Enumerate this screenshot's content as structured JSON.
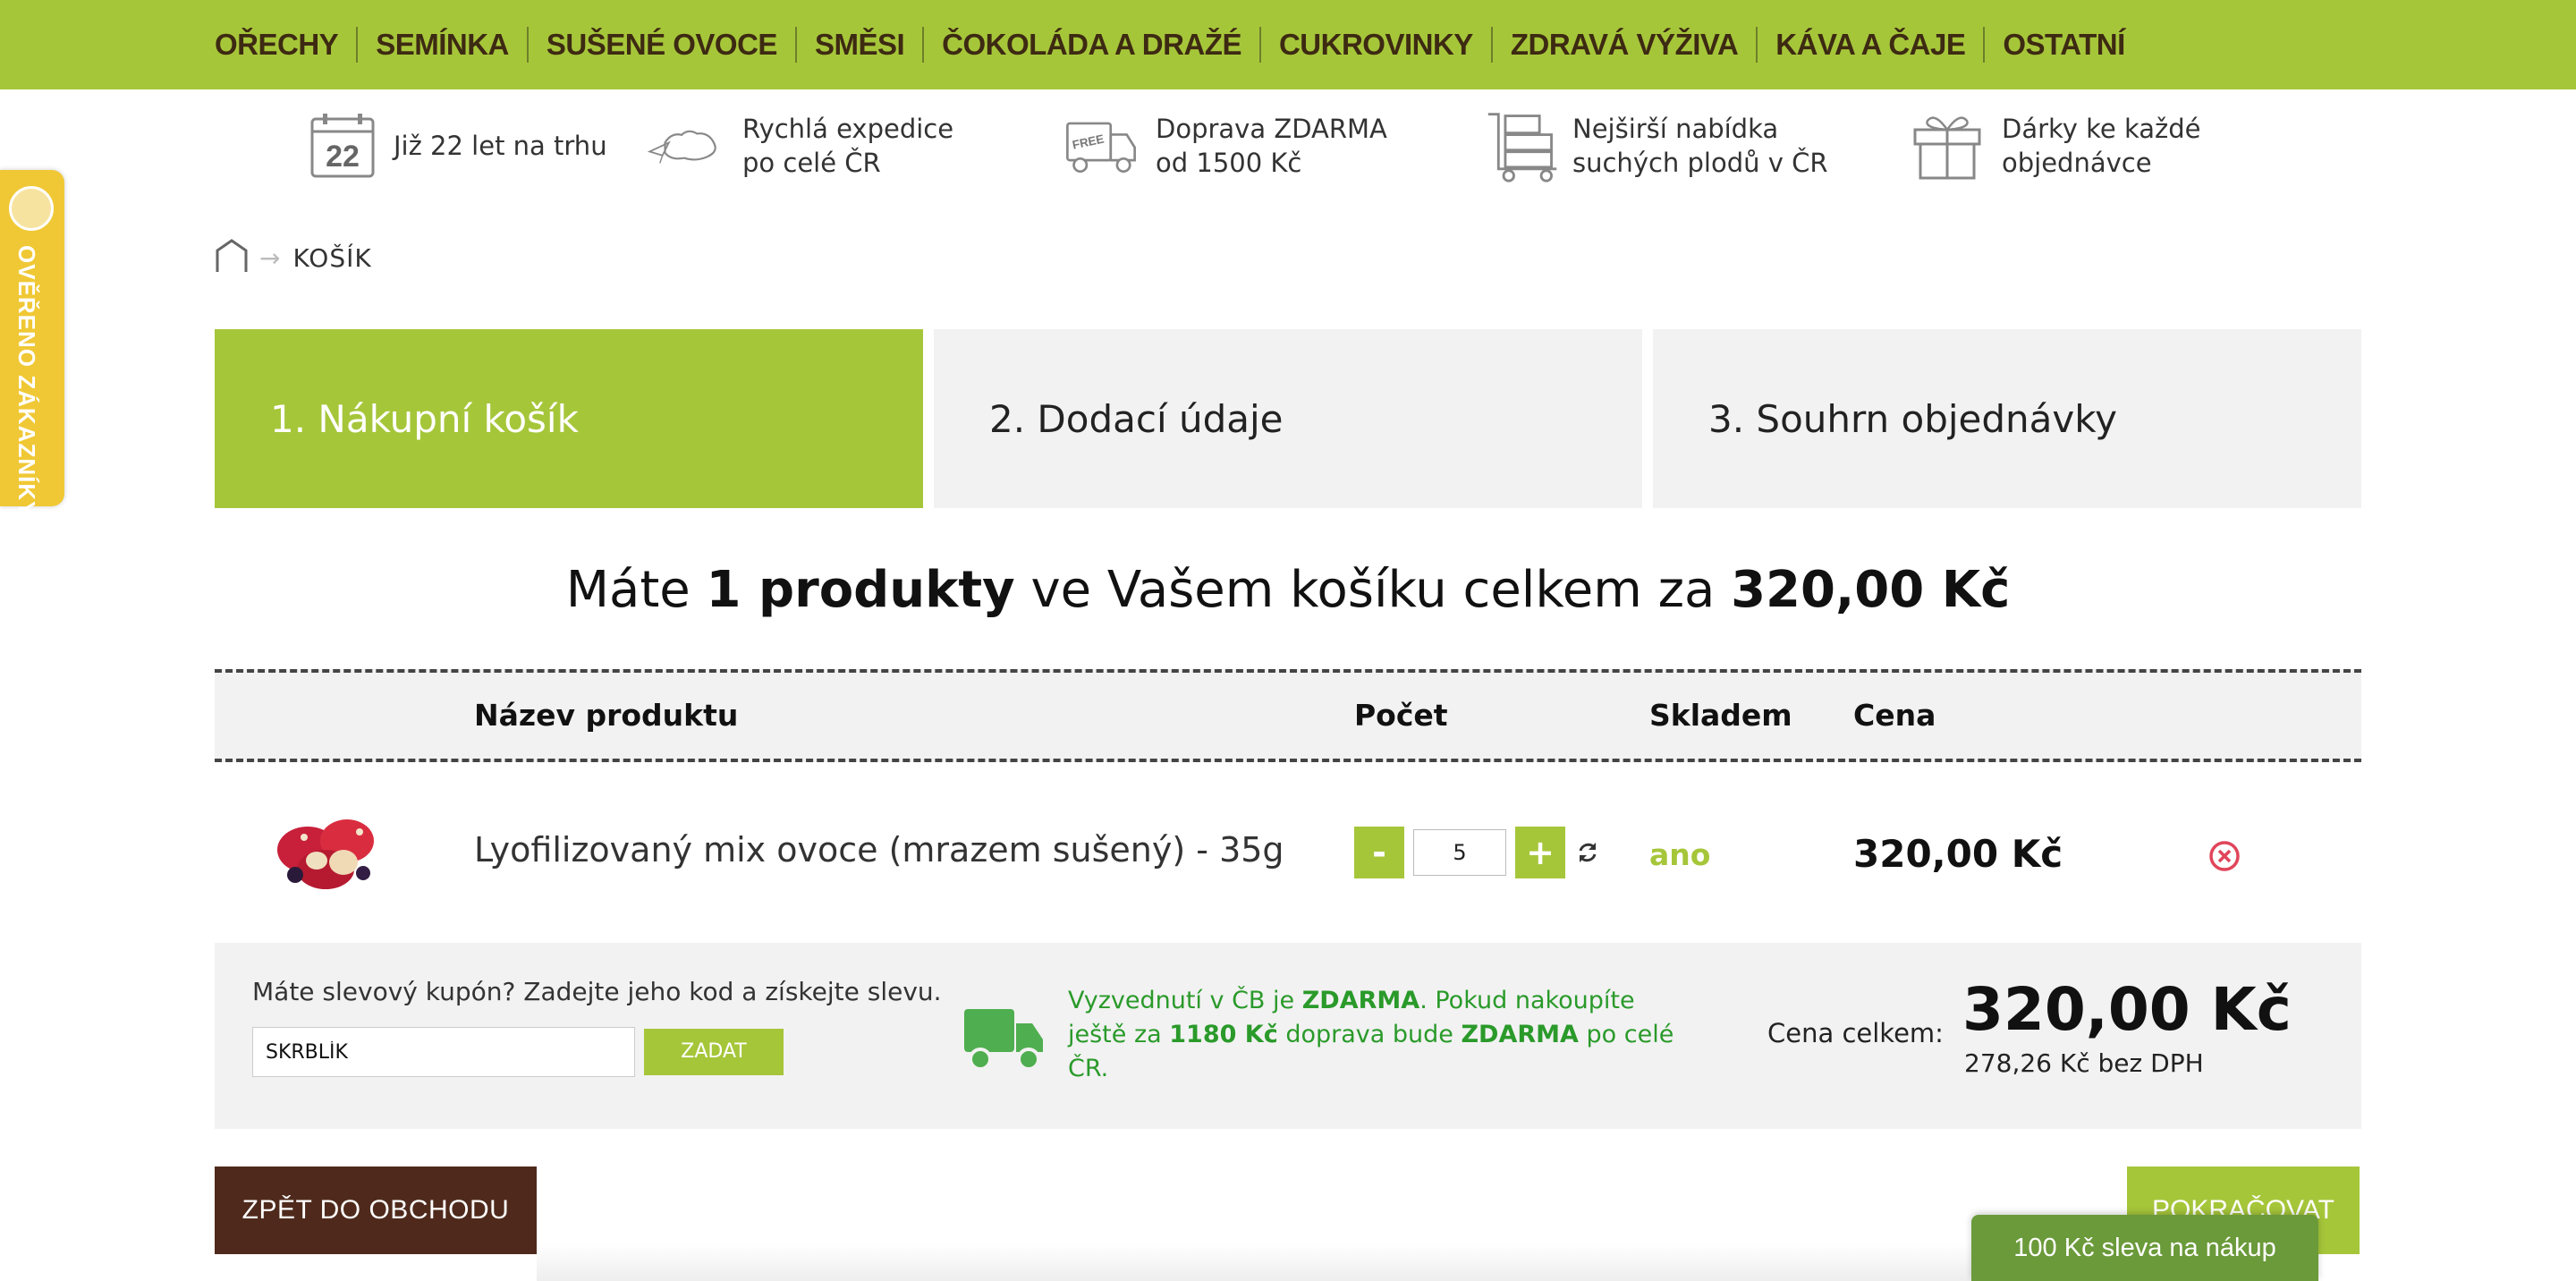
{
  "nav": {
    "items": [
      "OŘECHY",
      "SEMÍNKA",
      "SUŠENÉ OVOCE",
      "SMĚSI",
      "ČOKOLÁDA A DRAŽÉ",
      "CUKROVINKY",
      "ZDRAVÁ VÝŽIVA",
      "KÁVA A ČAJE",
      "OSTATNÍ"
    ]
  },
  "features": [
    {
      "icon": "calendar-icon",
      "line1": "Již 22 let na trhu",
      "line2": "",
      "calendar_number": "22"
    },
    {
      "icon": "paper-plane-map-icon",
      "line1": "Rychlá expedice",
      "line2": "po celé ČR"
    },
    {
      "icon": "free-delivery-truck-icon",
      "line1": "Doprava ZDARMA",
      "line2": "od 1500 Kč",
      "badge_text": "FREE"
    },
    {
      "icon": "warehouse-cart-icon",
      "line1": "Nejširší nabídka",
      "line2": "suchých plodů v ČR"
    },
    {
      "icon": "gift-icon",
      "line1": "Dárky ke každé",
      "line2": "objednávce"
    }
  ],
  "verified_badge": {
    "label": "OVĚŘENO ZÁKAZNÍKY"
  },
  "breadcrumb": {
    "current": "KOŠÍK"
  },
  "steps": [
    {
      "label": "1. Nákupní košík",
      "active": true
    },
    {
      "label": "2. Dodací údaje",
      "active": false
    },
    {
      "label": "3. Souhrn objednávky",
      "active": false
    }
  ],
  "summary": {
    "prefix": "Máte ",
    "count": "1 produkty",
    "middle": " ve Vašem košíku celkem za ",
    "total": "320,00 Kč"
  },
  "table": {
    "headers": {
      "name": "Název produktu",
      "qty": "Počet",
      "stock": "Skladem",
      "price": "Cena"
    },
    "rows": [
      {
        "name": "Lyofilizovaný mix ovoce (mrazem sušený) - 35g",
        "qty": "5",
        "stock": "ano",
        "price": "320,00 Kč"
      }
    ],
    "minus_label": "-",
    "plus_label": "+"
  },
  "coupon": {
    "label": "Máte slevový kupón? Zadejte jeho kod a získejte slevu.",
    "value": "SKRBLÍK",
    "button": "ZADAT"
  },
  "delivery": {
    "t1": "Vyzvednutí v ČB je ",
    "b1": "ZDARMA",
    "t2": ". Pokud nakoupíte ještě za ",
    "b2": "1180 Kč",
    "t3": " doprava bude ",
    "b3": "ZDARMA",
    "t4": " po celé ČR."
  },
  "totals": {
    "label": "Cena celkem:",
    "value": "320,00 Kč",
    "without_vat": "278,26 Kč bez DPH"
  },
  "buttons": {
    "back": "ZPĚT DO OBCHODU",
    "continue": "POKRAČOVAT",
    "discount_tab": "100 Kč sleva na nákup"
  },
  "colors": {
    "accent_green": "#a6c63a",
    "brand_brown": "#4f2a1c",
    "delivery_text_green": "#2a9a2a",
    "remove_red": "#e0455a"
  }
}
